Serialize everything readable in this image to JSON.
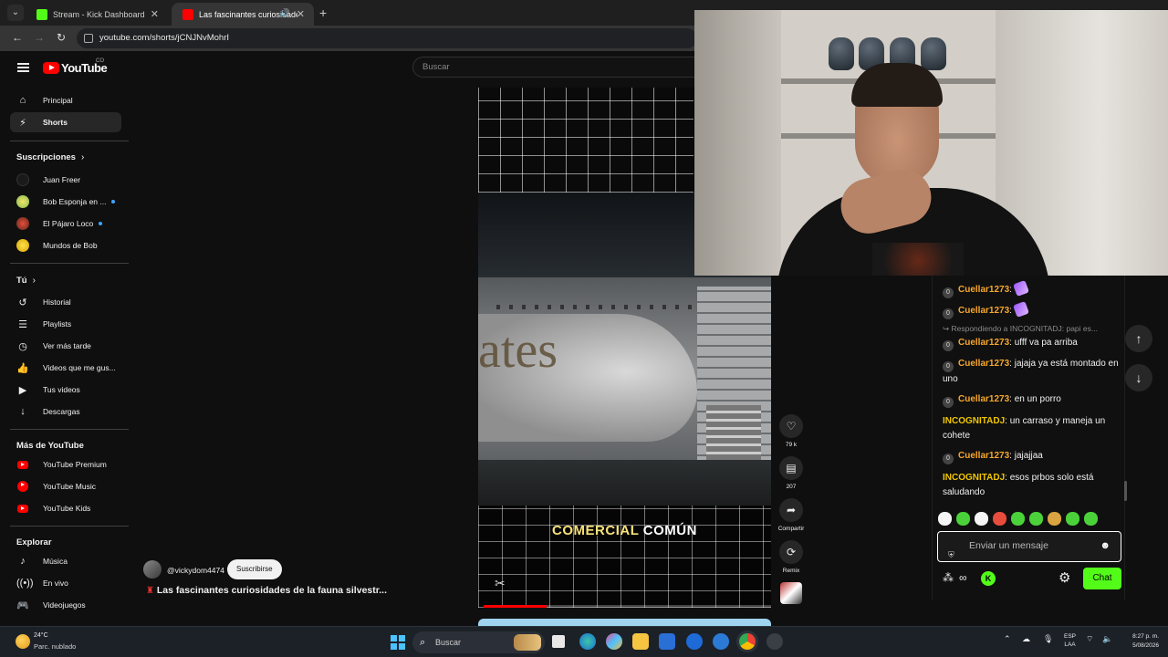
{
  "browser": {
    "tabs": [
      {
        "title": "Stream - Kick Dashboard",
        "active": false
      },
      {
        "title": "Las fascinantes curiosidades",
        "active": true
      }
    ],
    "url": "youtube.com/shorts/jCNJNvMohrI"
  },
  "youtube": {
    "logo_text": "YouTube",
    "country_code": "CO",
    "search_placeholder": "Buscar",
    "nav_main": [
      {
        "label": "Principal",
        "icon": "home-icon"
      },
      {
        "label": "Shorts",
        "icon": "shorts-icon",
        "active": true
      }
    ],
    "subscriptions_header": "Suscripciones",
    "subscriptions": [
      {
        "label": "Juan Freer",
        "new": false
      },
      {
        "label": "Bob Esponja en ...",
        "new": true
      },
      {
        "label": "El Pájaro Loco",
        "new": true
      },
      {
        "label": "Mundos de Bob",
        "new": false
      }
    ],
    "you_header": "Tú",
    "you_items": [
      {
        "label": "Historial",
        "icon": "history-icon"
      },
      {
        "label": "Playlists",
        "icon": "playlists-icon"
      },
      {
        "label": "Ver más tarde",
        "icon": "clock-icon"
      },
      {
        "label": "Videos que me gus...",
        "icon": "like-icon"
      },
      {
        "label": "Tus videos",
        "icon": "video-icon"
      },
      {
        "label": "Descargas",
        "icon": "download-icon"
      }
    ],
    "more_header": "Más de YouTube",
    "more_items": [
      {
        "label": "YouTube Premium"
      },
      {
        "label": "YouTube Music"
      },
      {
        "label": "YouTube Kids"
      }
    ],
    "explore_header": "Explorar",
    "explore_items": [
      {
        "label": "Música",
        "icon": "music-icon"
      },
      {
        "label": "En vivo",
        "icon": "live-icon"
      },
      {
        "label": "Videojuegos",
        "icon": "gaming-icon"
      }
    ],
    "short": {
      "caption_word1": "COMERCIAL",
      "caption_word2": "COMÚN",
      "livery_text": "ates",
      "progress_fraction": 0.22,
      "channel": "@vickydom4474",
      "subscribe_label": "Suscribirse",
      "title": "Las fascinantes curiosidades de la fauna silvestr...",
      "likes": "79 k",
      "comments": "207",
      "share_label": "Compartir",
      "remix_label": "Remix"
    }
  },
  "chat": {
    "messages": [
      {
        "user": "Cuellar1273",
        "text": "",
        "emote": true,
        "badge": "0"
      },
      {
        "user": "Cuellar1273",
        "text": "",
        "emote": true,
        "badge": "0"
      },
      {
        "user": "Cuellar1273",
        "text": "ufff va pa arriba",
        "badge": "0"
      },
      {
        "user": "Cuellar1273",
        "text": "jajaja ya está montado en uno",
        "badge": "0"
      },
      {
        "user": "Cuellar1273",
        "text": "en un porro",
        "badge": "0"
      },
      {
        "user": "INCOGNITADJ",
        "text": "un carraso y maneja un cohete",
        "badge": ""
      },
      {
        "user": "Cuellar1273",
        "text": "jajajjaa",
        "badge": "0"
      },
      {
        "user": "INCOGNITADJ",
        "text": "esos prbos solo está saludando",
        "badge": ""
      }
    ],
    "reply_to": "Respondiendo a INCOGNITADJ: papi es...",
    "input_placeholder": "Enviar un mensaje",
    "send_label": "Chat",
    "colors": {
      "kick_green": "#53fc18",
      "user_orange": "#f7a72b",
      "user_yellow": "#f0c600"
    }
  },
  "taskbar": {
    "temperature": "24°C",
    "weather": "Parc. nublado",
    "search_label": "Buscar",
    "lang_line1": "ESP",
    "lang_line2": "LAA",
    "time": "8:27 p. m.",
    "date": "5/08/2026"
  }
}
